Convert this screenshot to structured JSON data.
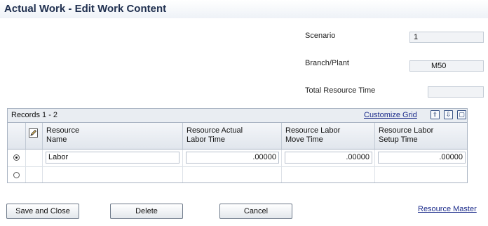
{
  "header": {
    "title": "Actual Work - Edit Work Content"
  },
  "form": {
    "scenario": {
      "label": "Scenario",
      "value": "1"
    },
    "branch_plant": {
      "label": "Branch/Plant",
      "value": "M50"
    },
    "total_resource_time": {
      "label": "Total Resource Time",
      "value": ""
    }
  },
  "grid": {
    "records_label": "Records 1 - 2",
    "customize_label": "Customize Grid",
    "toolbar_icons": [
      "export-icon",
      "import-icon",
      "maximize-icon"
    ],
    "columns": [
      {
        "line1": "Resource",
        "line2": "Name"
      },
      {
        "line1": "Resource Actual",
        "line2": "Labor Time"
      },
      {
        "line1": "Resource Labor",
        "line2": "Move Time"
      },
      {
        "line1": "Resource Labor",
        "line2": "Setup Time"
      }
    ],
    "rows": [
      {
        "selected": true,
        "name": "Labor",
        "actual": ".00000",
        "move": ".00000",
        "setup": ".00000"
      },
      {
        "selected": false,
        "name": "",
        "actual": "",
        "move": "",
        "setup": ""
      }
    ]
  },
  "buttons": {
    "save_close": "Save and Close",
    "delete": "Delete",
    "cancel": "Cancel"
  },
  "links": {
    "resource_master": "Resource Master"
  }
}
